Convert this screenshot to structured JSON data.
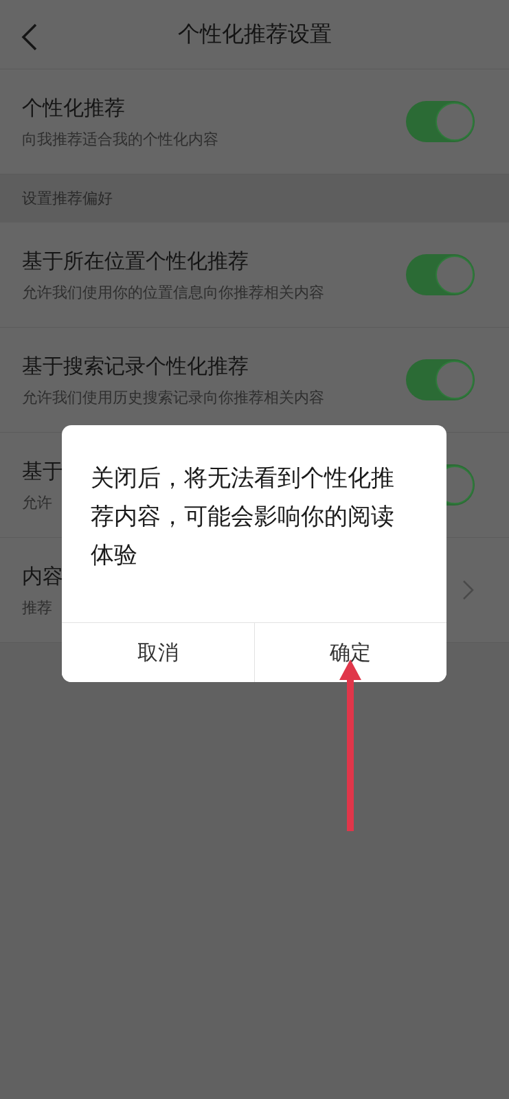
{
  "header": {
    "title": "个性化推荐设置"
  },
  "rows": [
    {
      "kind": "toggle",
      "title": "个性化推荐",
      "subtitle": "向我推荐适合我的个性化内容",
      "on": true
    },
    {
      "kind": "section",
      "title": "设置推荐偏好"
    },
    {
      "kind": "toggle",
      "title": "基于所在位置个性化推荐",
      "subtitle": "允许我们使用你的位置信息向你推荐相关内容",
      "on": true
    },
    {
      "kind": "toggle",
      "title": "基于搜索记录个性化推荐",
      "subtitle": "允许我们使用历史搜索记录向你推荐相关内容",
      "on": true
    },
    {
      "kind": "toggle",
      "title": "基于",
      "subtitle": "允许",
      "on": true
    },
    {
      "kind": "link",
      "title": "内容",
      "subtitle": "推荐"
    }
  ],
  "dialog": {
    "message": "关闭后，将无法看到个性化推荐内容，可能会影响你的阅读体验",
    "buttons": [
      "取消",
      "确定"
    ]
  }
}
